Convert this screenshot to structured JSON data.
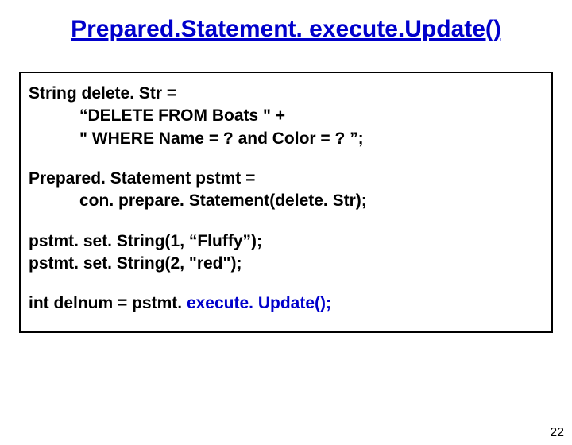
{
  "title": "Prepared.Statement. execute.Update()",
  "code": {
    "block1": {
      "line1": "String delete. Str =",
      "line2": "“DELETE FROM Boats \" +",
      "line3": "\" WHERE Name = ? and Color = ? ”;"
    },
    "block2": {
      "line1": "Prepared. Statement pstmt =",
      "line2": "con. prepare. Statement(delete. Str);"
    },
    "block3": {
      "line1": "pstmt. set. String(1, “Fluffy”);",
      "line2": "pstmt. set. String(2, \"red\");"
    },
    "block4": {
      "prefix": "int delnum = pstmt. ",
      "call": "execute. Update();"
    }
  },
  "page_number": "22"
}
